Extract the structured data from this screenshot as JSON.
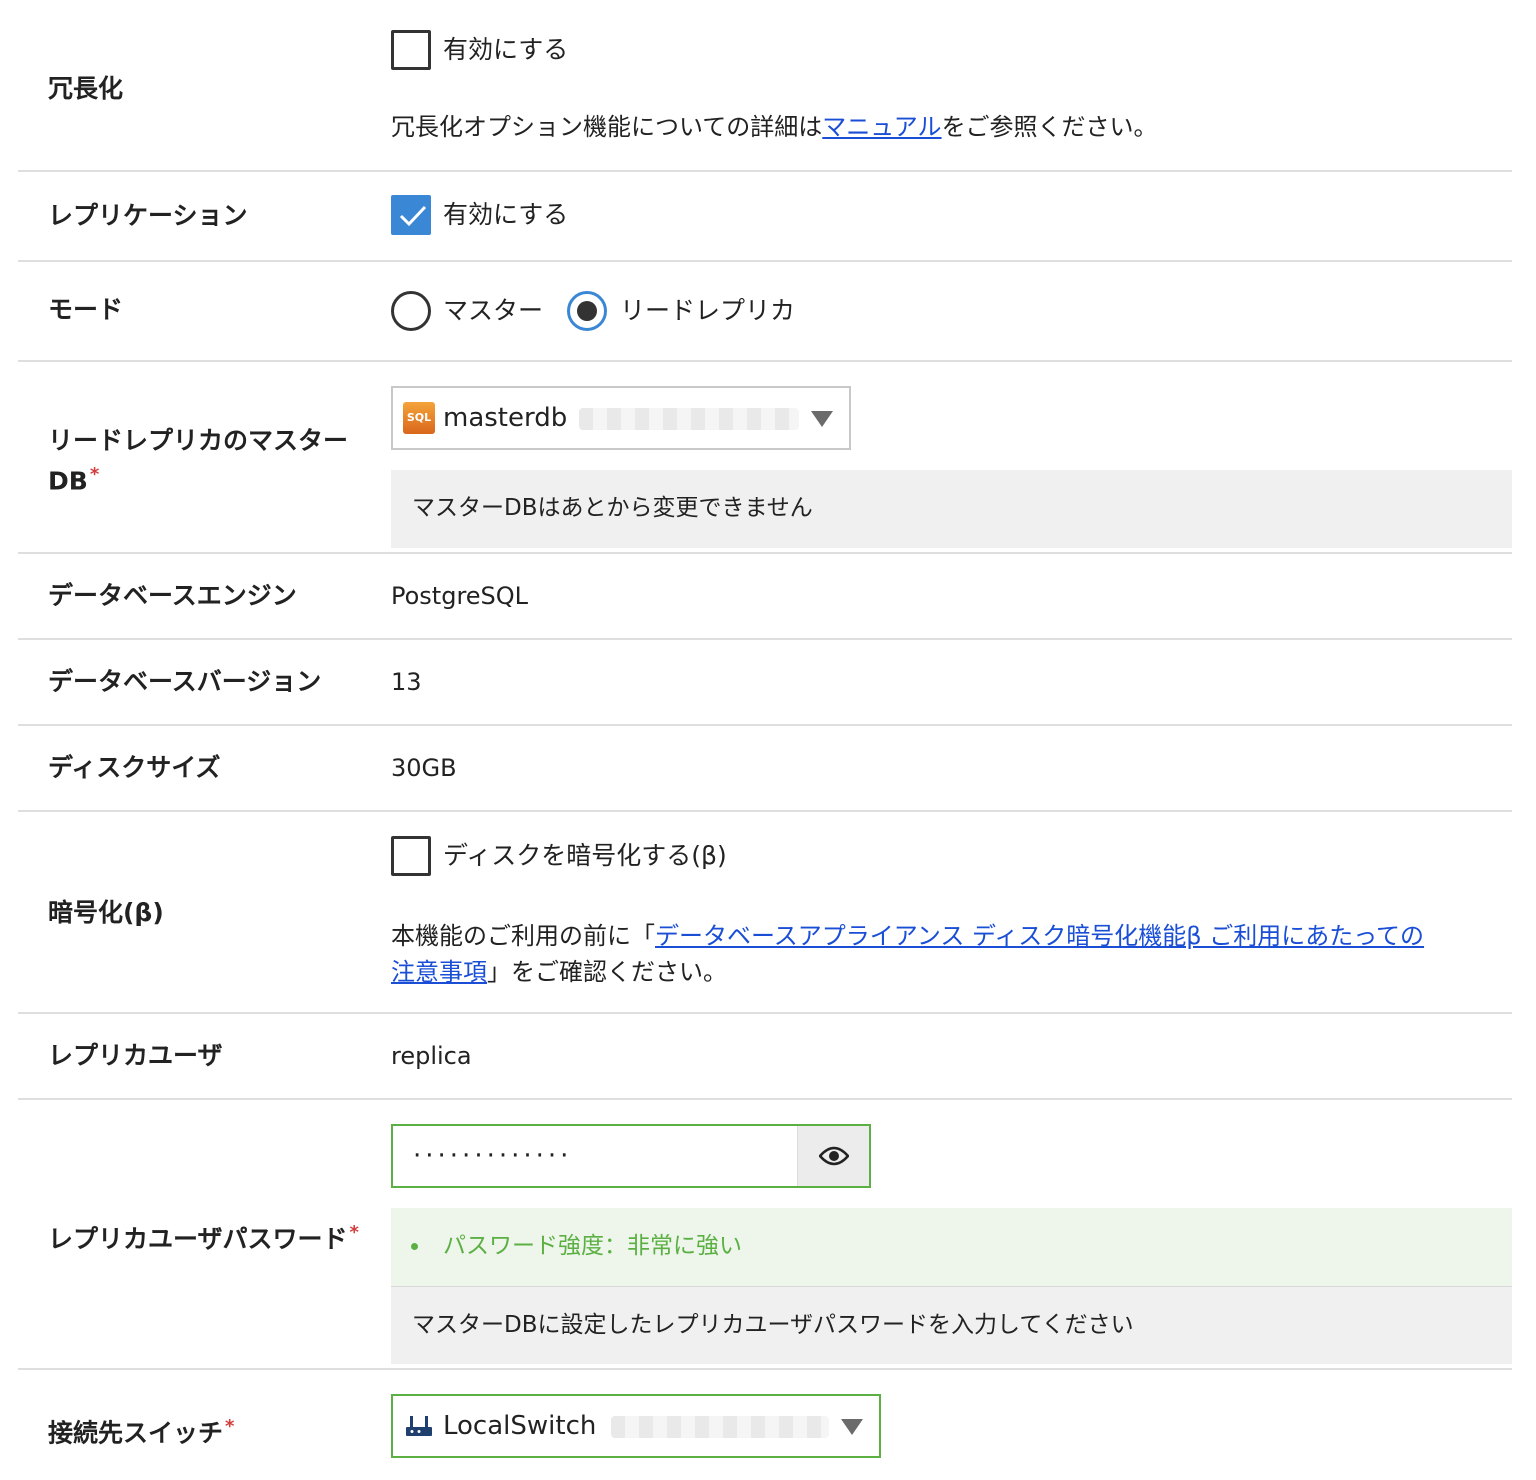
{
  "redundancy": {
    "label": "冗長化",
    "checkbox_label": "有効にする",
    "checked": false,
    "help_before": "冗長化オプション機能についての詳細は",
    "help_link": "マニュアル",
    "help_after": "をご参照ください。"
  },
  "replication": {
    "label": "レプリケーション",
    "checkbox_label": "有効にする",
    "checked": true
  },
  "mode": {
    "label": "モード",
    "options": [
      "マスター",
      "リードレプリカ"
    ],
    "selected": "リードレプリカ"
  },
  "master_db": {
    "label_line1": "リードレプリカのマスター",
    "label_line2": "DB",
    "required_mark": "*",
    "icon_text": "SQL",
    "value": "masterdb",
    "note": "マスターDBはあとから変更できません"
  },
  "engine": {
    "label": "データベースエンジン",
    "value": "PostgreSQL"
  },
  "version": {
    "label": "データベースバージョン",
    "value": "13"
  },
  "disk_size": {
    "label": "ディスクサイズ",
    "value": "30GB"
  },
  "encryption": {
    "label": "暗号化(β)",
    "checkbox_label": "ディスクを暗号化する(β)",
    "checked": false,
    "help_before": "本機能のご利用の前に「",
    "help_link_line1": "データベースアプライアンス ディスク暗号化機能β ご利用にあたっての",
    "help_link_line2": "注意事項",
    "help_after": "」をご確認ください。"
  },
  "replica_user": {
    "label": "レプリカユーザ",
    "value": "replica"
  },
  "replica_password": {
    "label": "レプリカユーザパスワード",
    "required_mark": "*",
    "masked_value": "·············",
    "strength": "パスワード強度：非常に強い",
    "note": "マスターDBに設定したレプリカユーザパスワードを入力してください"
  },
  "switch": {
    "label": "接続先スイッチ",
    "required_mark": "*",
    "value": "LocalSwitch"
  },
  "colors": {
    "accent": "#3a87d6",
    "success": "#5cb043",
    "link": "#1a4ed6",
    "required": "#d23c3c"
  }
}
